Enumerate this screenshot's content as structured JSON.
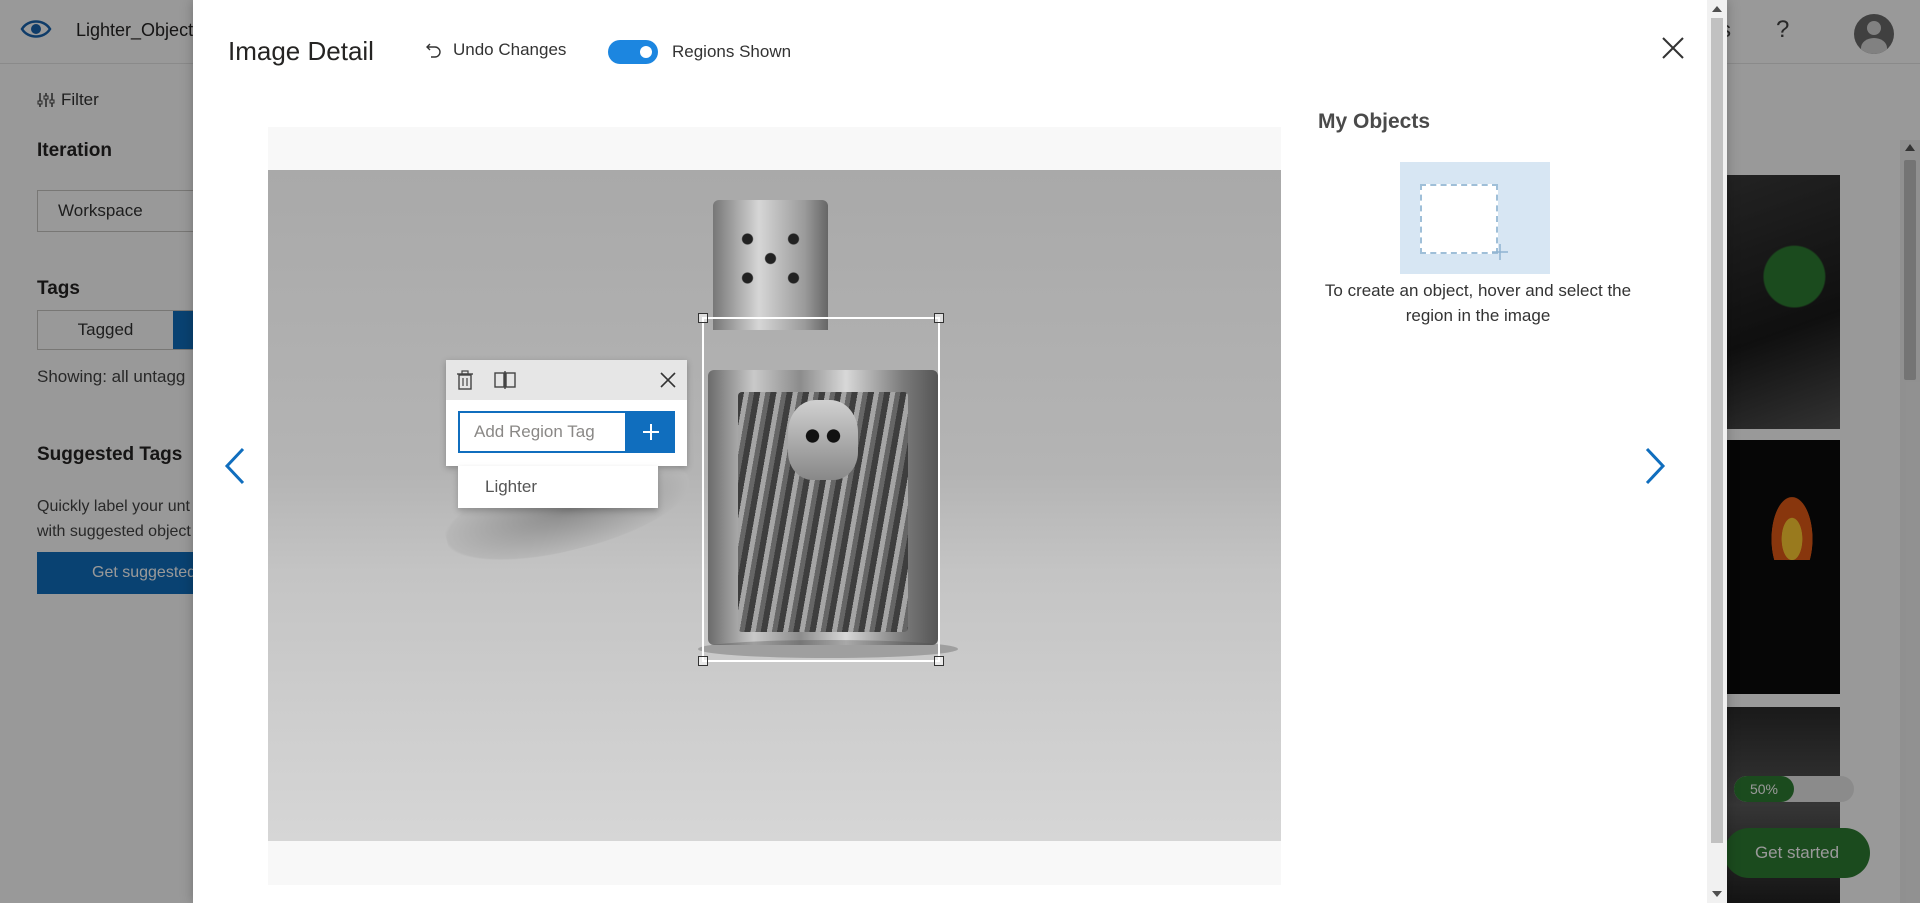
{
  "app": {
    "project_name": "Lighter_Object",
    "help_glyph": "?",
    "filter_label": "Filter",
    "iteration_heading": "Iteration",
    "iteration_value": "Workspace",
    "tags_heading": "Tags",
    "tag_filter_tagged": "Tagged",
    "showing_text": "Showing: all untagg",
    "suggested_tags_heading": "Suggested Tags",
    "suggested_tags_desc": "Quickly label your unt with suggested object",
    "suggest_button": "Get suggested",
    "progress_percent": 50,
    "progress_label": "50%",
    "get_started_label": "Get started"
  },
  "modal": {
    "title": "Image Detail",
    "undo_label": "Undo Changes",
    "regions_toggle_label": "Regions Shown",
    "regions_toggle_on": true,
    "region_tag": {
      "input_placeholder": "Add Region Tag",
      "input_value": "",
      "suggestion": "Lighter"
    },
    "objects": {
      "heading": "My Objects",
      "hint": "To create an object, hover and select the region in the image"
    }
  },
  "colors": {
    "accent_blue": "#106ebe",
    "toggle_blue": "#1c86e0",
    "get_started_green": "#2e7d32"
  },
  "icons": [
    "eye-icon",
    "filter-icon",
    "help-icon",
    "avatar-icon",
    "undo-icon",
    "close-icon",
    "delete-icon",
    "compare-icon",
    "plus-icon",
    "chevron-left-icon",
    "chevron-right-icon"
  ]
}
